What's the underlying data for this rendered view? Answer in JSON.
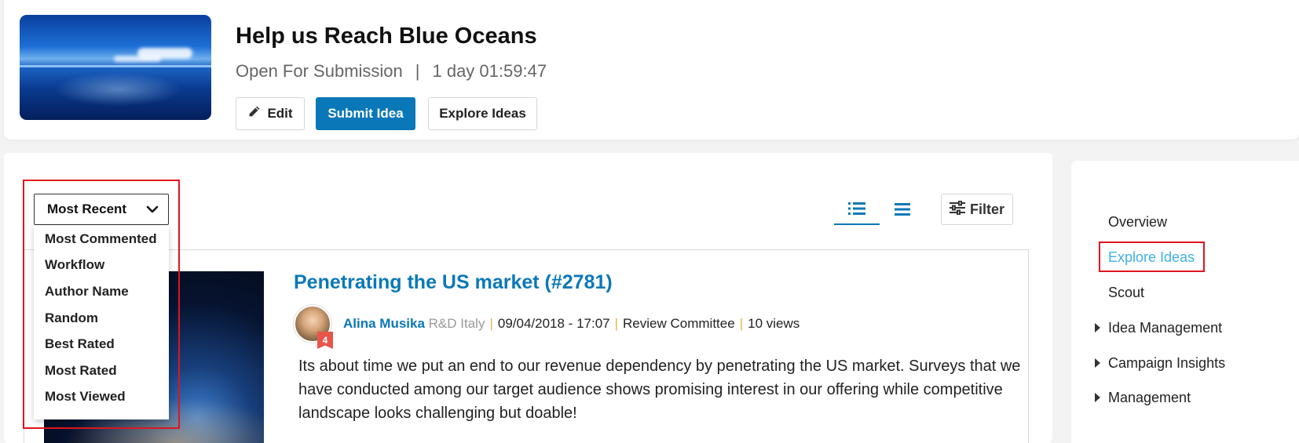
{
  "header": {
    "title": "Help us Reach Blue Oceans",
    "status": "Open For Submission",
    "separator": "|",
    "countdown": "1 day 01:59:47",
    "buttons": {
      "edit": "Edit",
      "submit": "Submit Idea",
      "explore": "Explore Ideas"
    }
  },
  "toolbar": {
    "sort_selected": "Most Recent",
    "sort_options": [
      "Most Commented",
      "Workflow",
      "Author Name",
      "Random",
      "Best Rated",
      "Most Rated",
      "Most Viewed"
    ],
    "filter_label": "Filter"
  },
  "idea": {
    "title": "Penetrating the US market (#2781)",
    "author": "Alina Musika",
    "department": "R&D Italy",
    "date": "09/04/2018 - 17:07",
    "stage": "Review Committee",
    "views": "10 views",
    "badge": "4",
    "description": "Its about time we put an end to our revenue dependency by penetrating the US market. Surveys that we have conducted among our target audience shows promising interest in our offering while competitive landscape looks challenging but doable!"
  },
  "sidebar": {
    "items": [
      {
        "label": "Overview"
      },
      {
        "label": "Explore Ideas"
      },
      {
        "label": "Scout"
      },
      {
        "label": "Idea Management"
      },
      {
        "label": "Campaign Insights"
      },
      {
        "label": "Management"
      }
    ]
  },
  "colors": {
    "accent": "#0a78b8",
    "active_nav": "#3fb0e8",
    "highlight_box": "#e0141e"
  }
}
